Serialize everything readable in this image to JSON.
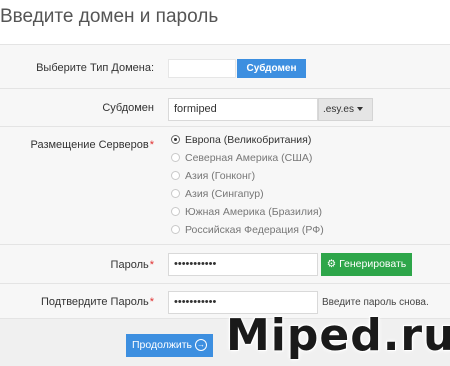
{
  "page_title": "Введите домен и пароль",
  "domain_type": {
    "label": "Выберите Тип Домена:",
    "selected": "Субдомен"
  },
  "subdomain": {
    "label": "Субдомен",
    "value": "formiped",
    "suffix": ".esy.es"
  },
  "server_location": {
    "label": "Размещение Серверов",
    "required_mark": "*",
    "options": [
      {
        "label": "Европа (Великобритания)",
        "selected": true
      },
      {
        "label": "Северная Америка (США)",
        "selected": false
      },
      {
        "label": "Азия (Гонконг)",
        "selected": false
      },
      {
        "label": "Азия (Сингапур)",
        "selected": false
      },
      {
        "label": "Южная Америка (Бразилия)",
        "selected": false
      },
      {
        "label": "Российская Федерация (РФ)",
        "selected": false
      }
    ]
  },
  "password": {
    "label": "Пароль",
    "required_mark": "*",
    "value": "•••••••••••",
    "generate_label": "Генерировать"
  },
  "confirm_password": {
    "label": "Подтвердите Пароль",
    "required_mark": "*",
    "value": "•••••••••••",
    "hint": "Введите пароль снова."
  },
  "continue_label": "Продолжить",
  "watermark": "Miped.ru",
  "colors": {
    "primary": "#3d8fe0",
    "success": "#2ea64a",
    "required": "#e03030"
  }
}
